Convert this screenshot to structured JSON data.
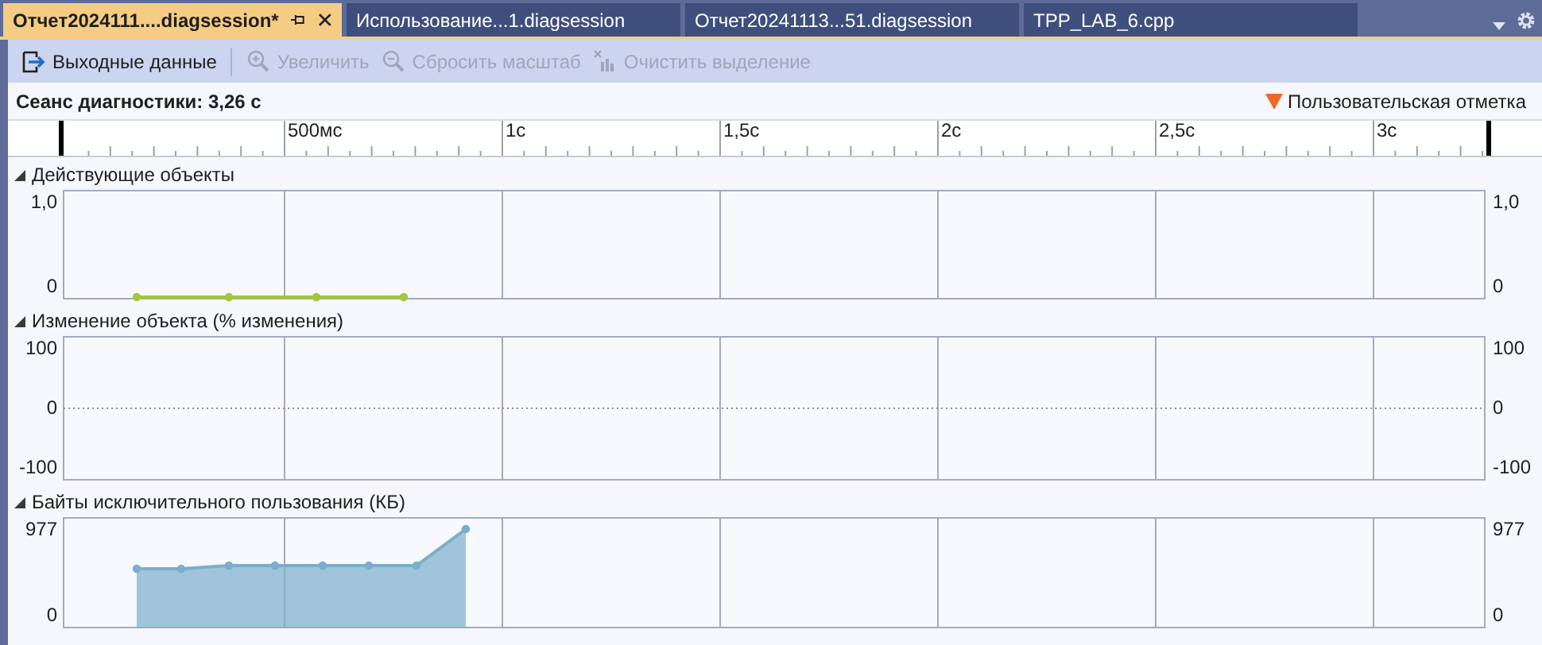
{
  "tabs": [
    {
      "label": "Отчет2024111....diagsession*",
      "selected": true
    },
    {
      "label": "Использование...1.diagsession",
      "selected": false
    },
    {
      "label": "Отчет20241113...51.diagsession",
      "selected": false
    },
    {
      "label": "TPP_LAB_6.cpp",
      "selected": false
    }
  ],
  "toolbar": [
    {
      "label": "Выходные данные",
      "kind": "export",
      "disabled": false
    },
    {
      "label": "Увеличить",
      "kind": "zoom-in",
      "disabled": true
    },
    {
      "label": "Сбросить масштаб",
      "kind": "zoom-out",
      "disabled": true
    },
    {
      "label": "Очистить выделение",
      "kind": "clear",
      "disabled": true
    }
  ],
  "session": {
    "label": "Сеанс диагностики: 3,26 с",
    "legend": "Пользовательская отметка"
  },
  "ruler": {
    "labels": [
      "500мс",
      "1с",
      "1,5с",
      "2с",
      "2,5с",
      "3с"
    ]
  },
  "sections": [
    {
      "title": "Действующие объекты",
      "expanded": true,
      "kind": "line",
      "left_labels": [
        "1,0",
        "0"
      ],
      "right_labels": [
        "1,0",
        "0"
      ]
    },
    {
      "title": "Изменение объекта (% изменения)",
      "expanded": true,
      "kind": "empty",
      "left_labels": [
        "100",
        "0",
        "-100"
      ],
      "right_labels": [
        "100",
        "0",
        "-100"
      ]
    },
    {
      "title": "Байты исключительного пользования (КБ)",
      "expanded": true,
      "kind": "area",
      "left_labels": [
        "977",
        "0"
      ],
      "right_labels": [
        "977",
        "0"
      ]
    }
  ]
}
